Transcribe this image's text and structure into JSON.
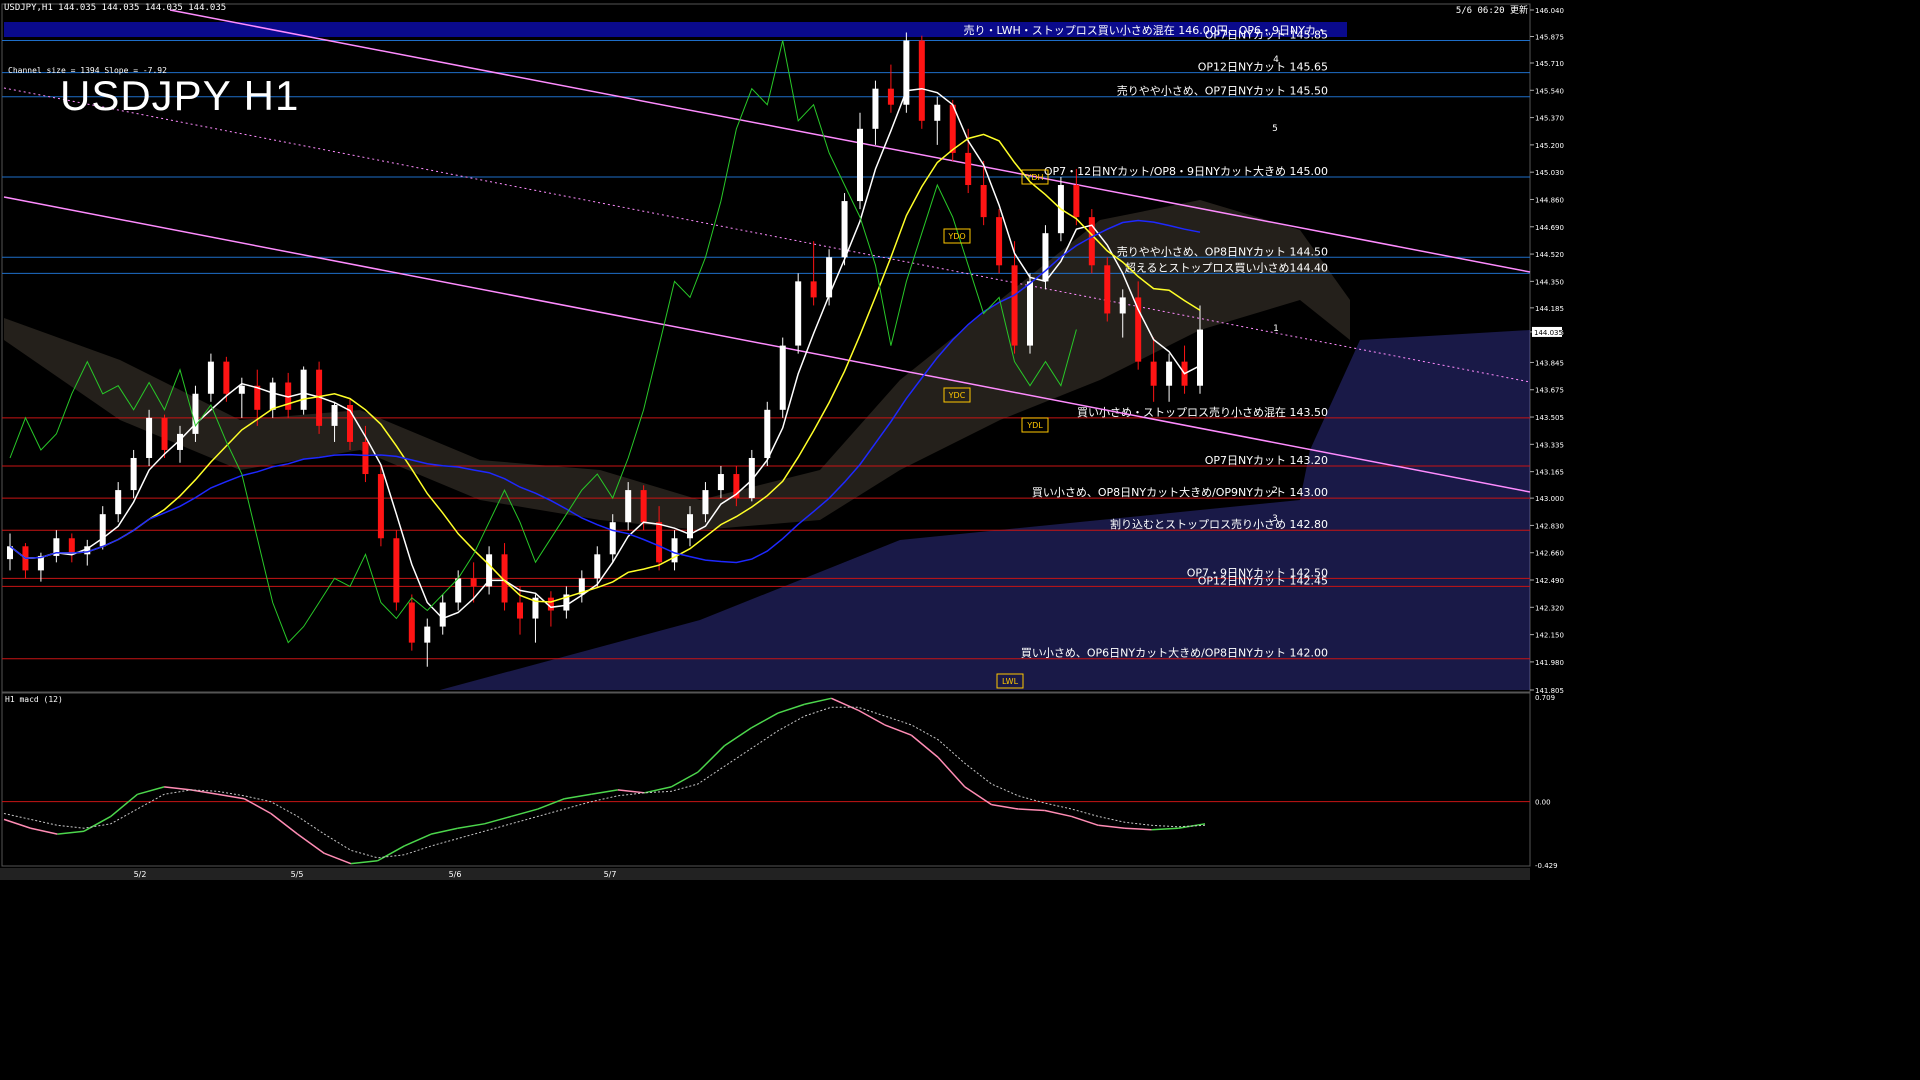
{
  "header": {
    "symbol_line": "USDJPY,H1  144.035 144.035 144.035 144.035",
    "time_label": "5/6 06:20 更新",
    "channel_info": "Channel size = 1394 Slope = -7.92",
    "big_title": "USDJPY H1"
  },
  "colors": {
    "background": "#000000",
    "hline_red": "#c81414",
    "hline_blue": "#1e6ec8",
    "channel": "#ff8cff",
    "ma_short": "#ffffff",
    "ma_mid": "#ffff28",
    "ma_long": "#1e28ff",
    "chikou": "#28c828",
    "cloud_upper": "#c8b496",
    "cloud_lower": "#5a5aff",
    "bull_candle": "#ffffff",
    "bear_candle": "#ff1414",
    "macd_line": "#4cd64c",
    "macd_line_neg": "#ff8cb4",
    "macd_signal": "#c8c8c8"
  },
  "chart_data": {
    "type": "candlestick",
    "title": "USDJPY H1",
    "timeframe": "H1",
    "ylim": [
      141.805,
      146.04
    ],
    "y_ticks": [
      "146.040",
      "145.875",
      "145.710",
      "145.540",
      "145.370",
      "145.200",
      "145.030",
      "144.860",
      "144.690",
      "144.520",
      "144.350",
      "144.185",
      "144.035",
      "143.845",
      "143.675",
      "143.505",
      "143.335",
      "143.165",
      "143.000",
      "142.830",
      "142.660",
      "142.490",
      "142.320",
      "142.150",
      "141.980",
      "141.805"
    ],
    "current_price": "144.035",
    "x_labels": [
      "5/2",
      "5/5",
      "5/6",
      "5/7"
    ],
    "horizontal_levels": [
      {
        "price": 145.85,
        "color": "blue",
        "label": "OP7日NYカット 145.85"
      },
      {
        "price": 145.65,
        "color": "blue",
        "label": "OP12日NYカット 145.65"
      },
      {
        "price": 145.5,
        "color": "blue",
        "label": "売りやや小さめ、OP7日NYカット 145.50"
      },
      {
        "price": 145.0,
        "color": "blue",
        "label": "OP7・12日NYカット/OP8・9日NYカット大きめ 145.00"
      },
      {
        "price": 144.5,
        "color": "blue",
        "label": "売りやや小さめ、OP8日NYカット 144.50"
      },
      {
        "price": 144.4,
        "color": "blue",
        "label": "超えるとストップロス買い小さめ144.40"
      },
      {
        "price": 143.5,
        "color": "red",
        "label": "買い小さめ・ストップロス売り小さめ混在 143.50"
      },
      {
        "price": 143.2,
        "color": "red",
        "label": "OP7日NYカット 143.20"
      },
      {
        "price": 143.0,
        "color": "red",
        "label": "買い小さめ、OP8日NYカット大きめ/OP9NYカット 143.00"
      },
      {
        "price": 142.8,
        "color": "red",
        "label": "割り込むとストップロス売り小さめ 142.80"
      },
      {
        "price": 142.5,
        "color": "red",
        "label": "OP7・9日NYカット 142.50"
      },
      {
        "price": 142.45,
        "color": "red",
        "label": "OP12日NYカット 142.45"
      },
      {
        "price": 142.0,
        "color": "red",
        "label": "買い小さめ、OP6日NYカット大きめ/OP8日NYカット 142.00"
      }
    ],
    "top_banner": "売り・LWH・ストップロス買い小さめ混在 146.00円、OP6・9日NYカ・",
    "markers": {
      "ydh": "YDH",
      "ydo": "YDO",
      "ydc": "YDC",
      "ydl": "YDL",
      "lwl": "LWL",
      "wave_labels": [
        "4",
        "5",
        "1",
        "2",
        "3"
      ]
    },
    "candles": [
      [
        142.62,
        142.78,
        142.55,
        142.7
      ],
      [
        142.7,
        142.72,
        142.5,
        142.55
      ],
      [
        142.55,
        142.66,
        142.48,
        142.64
      ],
      [
        142.64,
        142.8,
        142.6,
        142.75
      ],
      [
        142.75,
        142.78,
        142.6,
        142.65
      ],
      [
        142.65,
        142.74,
        142.58,
        142.7
      ],
      [
        142.7,
        142.95,
        142.68,
        142.9
      ],
      [
        142.9,
        143.1,
        142.85,
        143.05
      ],
      [
        143.05,
        143.3,
        143.0,
        143.25
      ],
      [
        143.25,
        143.55,
        143.2,
        143.5
      ],
      [
        143.5,
        143.52,
        143.25,
        143.3
      ],
      [
        143.3,
        143.45,
        143.22,
        143.4
      ],
      [
        143.4,
        143.7,
        143.35,
        143.65
      ],
      [
        143.65,
        143.9,
        143.6,
        143.85
      ],
      [
        143.85,
        143.88,
        143.6,
        143.65
      ],
      [
        143.65,
        143.75,
        143.5,
        143.7
      ],
      [
        143.7,
        143.8,
        143.45,
        143.55
      ],
      [
        143.55,
        143.75,
        143.5,
        143.72
      ],
      [
        143.72,
        143.78,
        143.5,
        143.55
      ],
      [
        143.55,
        143.82,
        143.52,
        143.8
      ],
      [
        143.8,
        143.85,
        143.4,
        143.45
      ],
      [
        143.45,
        143.6,
        143.35,
        143.58
      ],
      [
        143.58,
        143.62,
        143.3,
        143.35
      ],
      [
        143.35,
        143.45,
        143.1,
        143.15
      ],
      [
        143.15,
        143.2,
        142.7,
        142.75
      ],
      [
        142.75,
        142.8,
        142.3,
        142.35
      ],
      [
        142.35,
        142.4,
        142.05,
        142.1
      ],
      [
        142.1,
        142.25,
        141.95,
        142.2
      ],
      [
        142.2,
        142.4,
        142.15,
        142.35
      ],
      [
        142.35,
        142.55,
        142.3,
        142.5
      ],
      [
        142.5,
        142.6,
        142.35,
        142.45
      ],
      [
        142.45,
        142.7,
        142.4,
        142.65
      ],
      [
        142.65,
        142.72,
        142.3,
        142.35
      ],
      [
        142.35,
        142.45,
        142.15,
        142.25
      ],
      [
        142.25,
        142.4,
        142.1,
        142.38
      ],
      [
        142.38,
        142.42,
        142.2,
        142.3
      ],
      [
        142.3,
        142.45,
        142.25,
        142.4
      ],
      [
        142.4,
        142.55,
        142.35,
        142.5
      ],
      [
        142.5,
        142.7,
        142.45,
        142.65
      ],
      [
        142.65,
        142.9,
        142.6,
        142.85
      ],
      [
        142.85,
        143.1,
        142.8,
        143.05
      ],
      [
        143.05,
        143.08,
        142.8,
        142.85
      ],
      [
        142.85,
        142.95,
        142.55,
        142.6
      ],
      [
        142.6,
        142.8,
        142.55,
        142.75
      ],
      [
        142.75,
        142.95,
        142.7,
        142.9
      ],
      [
        142.9,
        143.1,
        142.85,
        143.05
      ],
      [
        143.05,
        143.2,
        143.0,
        143.15
      ],
      [
        143.15,
        143.2,
        142.95,
        143.0
      ],
      [
        143.0,
        143.3,
        142.98,
        143.25
      ],
      [
        143.25,
        143.6,
        143.2,
        143.55
      ],
      [
        143.55,
        144.0,
        143.5,
        143.95
      ],
      [
        143.95,
        144.4,
        143.9,
        144.35
      ],
      [
        144.35,
        144.6,
        144.2,
        144.25
      ],
      [
        144.25,
        144.55,
        144.2,
        144.5
      ],
      [
        144.5,
        144.9,
        144.45,
        144.85
      ],
      [
        144.85,
        145.4,
        144.8,
        145.3
      ],
      [
        145.3,
        145.6,
        145.2,
        145.55
      ],
      [
        145.55,
        145.7,
        145.4,
        145.45
      ],
      [
        145.45,
        145.9,
        145.4,
        145.85
      ],
      [
        145.85,
        145.88,
        145.3,
        145.35
      ],
      [
        145.35,
        145.5,
        145.2,
        145.45
      ],
      [
        145.45,
        145.48,
        145.1,
        145.15
      ],
      [
        145.15,
        145.3,
        144.9,
        144.95
      ],
      [
        144.95,
        145.1,
        144.7,
        144.75
      ],
      [
        144.75,
        144.8,
        144.4,
        144.45
      ],
      [
        144.45,
        144.6,
        143.9,
        143.95
      ],
      [
        143.95,
        144.4,
        143.9,
        144.35
      ],
      [
        144.35,
        144.7,
        144.3,
        144.65
      ],
      [
        144.65,
        145.0,
        144.6,
        144.95
      ],
      [
        144.95,
        145.05,
        144.7,
        144.75
      ],
      [
        144.75,
        144.8,
        144.4,
        144.45
      ],
      [
        144.45,
        144.5,
        144.1,
        144.15
      ],
      [
        144.15,
        144.3,
        144.0,
        144.25
      ],
      [
        144.25,
        144.35,
        143.8,
        143.85
      ],
      [
        143.85,
        144.0,
        143.6,
        143.7
      ],
      [
        143.7,
        143.9,
        143.6,
        143.85
      ],
      [
        143.85,
        143.95,
        143.65,
        143.7
      ],
      [
        143.7,
        144.2,
        143.65,
        144.05
      ]
    ]
  },
  "macd": {
    "label": "H1  macd (12)",
    "y_ticks": [
      "0.709",
      "0.00",
      "-0.429"
    ],
    "values": [
      -0.12,
      -0.18,
      -0.22,
      -0.2,
      -0.1,
      0.05,
      0.1,
      0.08,
      0.05,
      0.02,
      -0.08,
      -0.22,
      -0.35,
      -0.42,
      -0.4,
      -0.3,
      -0.22,
      -0.18,
      -0.15,
      -0.1,
      -0.05,
      0.02,
      0.05,
      0.08,
      0.06,
      0.1,
      0.2,
      0.38,
      0.5,
      0.6,
      0.66,
      0.7,
      0.62,
      0.52,
      0.45,
      0.3,
      0.1,
      -0.02,
      -0.05,
      -0.06,
      -0.1,
      -0.16,
      -0.18,
      -0.19,
      -0.18,
      -0.15
    ],
    "signal": [
      -0.08,
      -0.12,
      -0.16,
      -0.18,
      -0.15,
      -0.05,
      0.05,
      0.08,
      0.07,
      0.04,
      0.0,
      -0.1,
      -0.22,
      -0.33,
      -0.38,
      -0.36,
      -0.3,
      -0.25,
      -0.2,
      -0.15,
      -0.1,
      -0.05,
      0.0,
      0.04,
      0.06,
      0.07,
      0.12,
      0.24,
      0.36,
      0.48,
      0.58,
      0.64,
      0.64,
      0.58,
      0.52,
      0.42,
      0.26,
      0.12,
      0.04,
      -0.01,
      -0.05,
      -0.1,
      -0.14,
      -0.16,
      -0.17,
      -0.16
    ]
  }
}
